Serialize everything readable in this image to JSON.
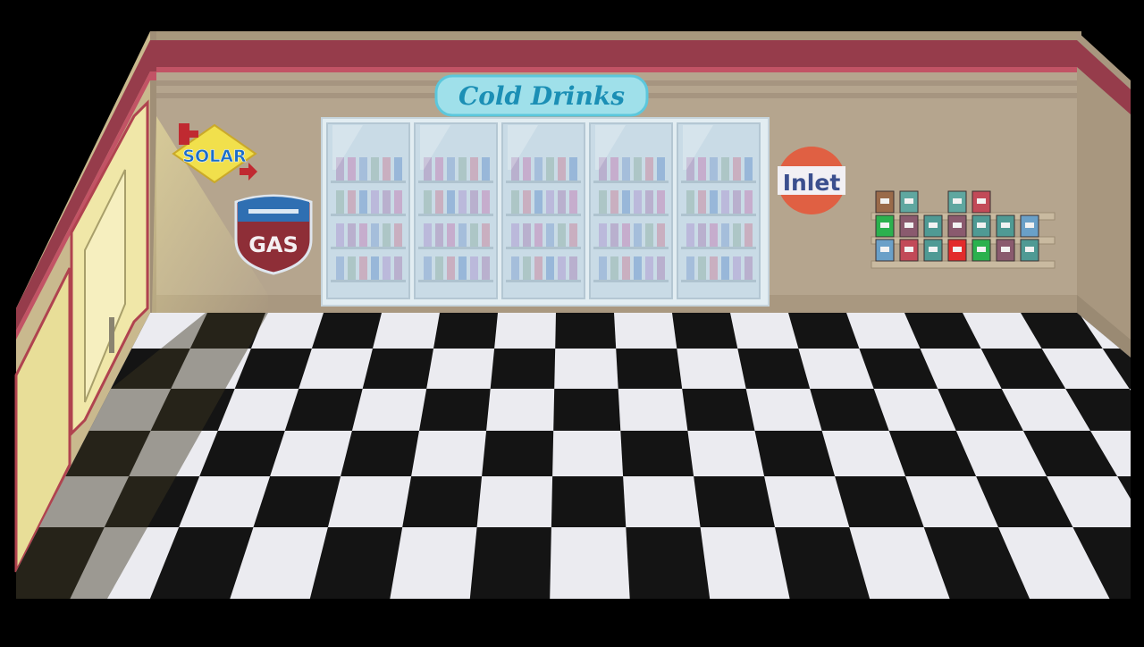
{
  "signs": {
    "cold_drinks": "Cold Drinks",
    "solar": "SOLAR",
    "gas": "GAS",
    "inlet": "Inlet"
  },
  "colors": {
    "background": "#000000",
    "wall": "#b5a58e",
    "wall_trim": "#963c4b",
    "floor_dark": "#141414",
    "floor_light": "#ebebf0",
    "fridge_glass": "#c9dbe6",
    "sign_teal": "#9fe0ea",
    "sign_text_blue": "#1b8fb5",
    "gas_red": "#8e2e37",
    "inlet_orange": "#e06043",
    "solar_yellow": "#f1e04c",
    "door_yellow": "#f0e7a8"
  },
  "icons": [
    "solar-sign-icon",
    "gas-shield-icon",
    "inlet-round-sign-icon",
    "drink-bottle-icon",
    "cigarette-pack-icon"
  ]
}
